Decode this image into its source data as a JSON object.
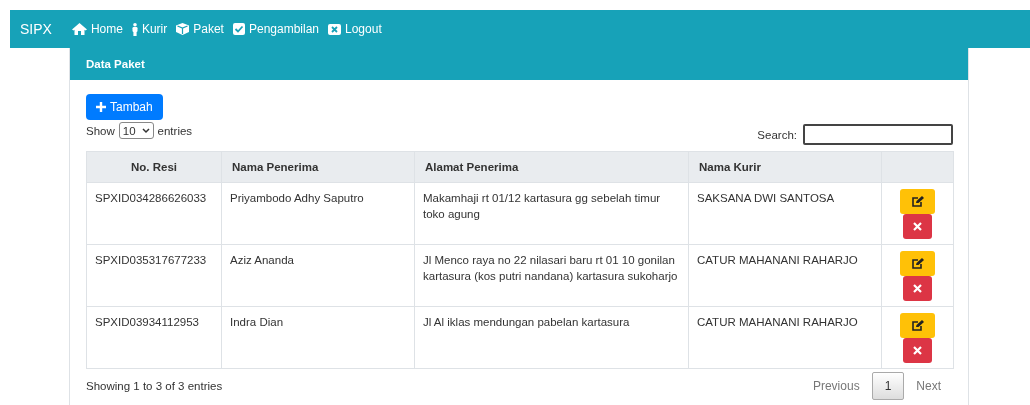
{
  "navbar": {
    "brand": "SIPX",
    "items": [
      {
        "label": "Home"
      },
      {
        "label": "Kurir"
      },
      {
        "label": "Paket"
      },
      {
        "label": "Pengambilan"
      },
      {
        "label": "Logout"
      }
    ]
  },
  "card": {
    "title": "Data Paket"
  },
  "add_button": {
    "label": "Tambah"
  },
  "length": {
    "prefix": "Show",
    "value": "10",
    "suffix": "entries"
  },
  "search": {
    "label": "Search:"
  },
  "table": {
    "columns": [
      "No. Resi",
      "Nama Penerima",
      "Alamat Penerima",
      "Nama Kurir"
    ],
    "rows": [
      {
        "cells": [
          "SPXID034286626033",
          "Priyambodo Adhy Saputro",
          "Makamhaji rt 01/12 kartasura gg sebelah timur toko agung",
          "SAKSANA DWI SANTOSA"
        ]
      },
      {
        "cells": [
          "SPXID035317677233",
          "Aziz Ananda",
          "Jl Menco raya no 22 nilasari baru rt 01 10 gonilan kartasura (kos putri nandana) kartasura sukoharjo",
          "CATUR MAHANANI RAHARJO"
        ]
      },
      {
        "cells": [
          "SPXID03934112953",
          "Indra Dian",
          "Jl Al iklas mendungan pabelan kartasura",
          "CATUR MAHANANI RAHARJO"
        ]
      }
    ]
  },
  "info": "Showing 1 to 3 of 3 entries",
  "pagination": {
    "previous": {
      "label": "Previous",
      "disabled": true
    },
    "pages": [
      {
        "label": "1",
        "selected": true
      }
    ],
    "next": {
      "label": "Next",
      "disabled": true
    }
  }
}
